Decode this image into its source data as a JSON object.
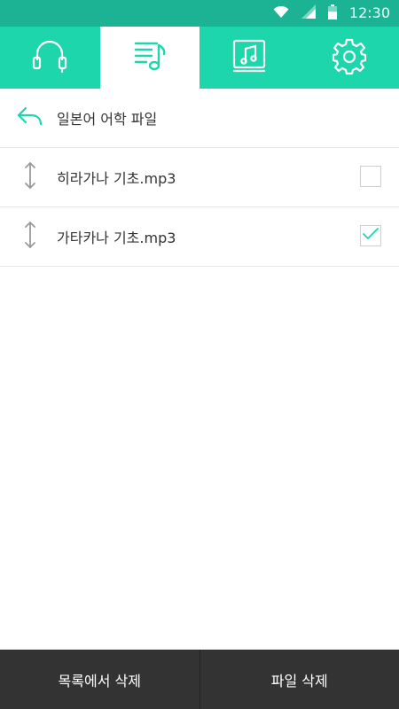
{
  "status_bar": {
    "time": "12:30"
  },
  "tabs": [
    {
      "icon": "headphones-icon"
    },
    {
      "icon": "playlist-icon",
      "active": true
    },
    {
      "icon": "music-album-icon"
    },
    {
      "icon": "gear-icon"
    }
  ],
  "header": {
    "title": "일본어 어학 파일",
    "back_icon": "back-arrow-icon"
  },
  "files": [
    {
      "name": "히라가나 기초.mp3",
      "checked": false
    },
    {
      "name": "가타카나 기초.mp3",
      "checked": true
    }
  ],
  "actions": {
    "remove_from_list": "목록에서 삭제",
    "delete_file": "파일 삭제"
  },
  "colors": {
    "accent": "#1dd6ac",
    "status_bar": "#1bb393",
    "bottom_bar": "#333333"
  }
}
